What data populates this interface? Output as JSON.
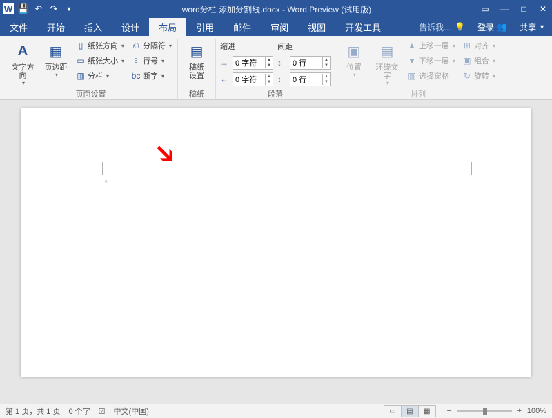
{
  "titlebar": {
    "title": "word分栏 添加分割线.docx - Word Preview (试用版)"
  },
  "tabs": {
    "file": "文件",
    "home": "开始",
    "insert": "插入",
    "design": "设计",
    "layout": "布局",
    "references": "引用",
    "mailings": "邮件",
    "review": "审阅",
    "view": "视图",
    "developer": "开发工具",
    "tellme": "告诉我...",
    "signin": "登录",
    "share": "共享"
  },
  "ribbon": {
    "pagesetup": {
      "text_dir": "文字方向",
      "margins": "页边距",
      "orientation": "纸张方向",
      "size": "纸张大小",
      "columns": "分栏",
      "breaks": "分隔符",
      "line_numbers": "行号",
      "hyphenation": "断字",
      "label": "页面设置"
    },
    "manuscript": {
      "btn": "稿纸\n设置",
      "label": "稿纸"
    },
    "paragraph": {
      "indent_label": "缩进",
      "spacing_label": "间距",
      "indent_left": "0 字符",
      "indent_right": "0 字符",
      "space_before": "0 行",
      "space_after": "0 行",
      "label": "段落"
    },
    "arrange": {
      "position": "位置",
      "wrap": "环绕文字",
      "bring_forward": "上移一层",
      "send_backward": "下移一层",
      "selection_pane": "选择窗格",
      "align": "对齐",
      "group": "组合",
      "rotate": "旋转",
      "label": "排列"
    }
  },
  "status": {
    "page": "第 1 页，共 1 页",
    "words": "0 个字",
    "lang": "中文(中国)",
    "zoom": "100%"
  }
}
